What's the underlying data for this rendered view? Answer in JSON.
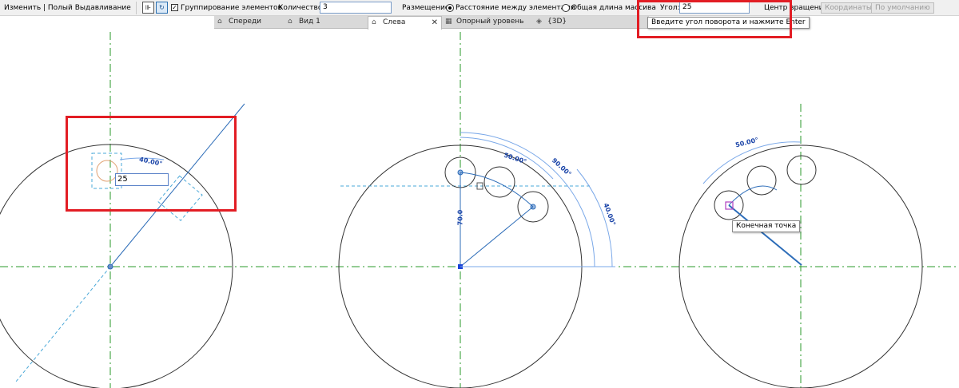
{
  "options_bar": {
    "context_label": "Изменить | Полый Выдавливание",
    "grouping_label": "Группирование элементов",
    "grouping_checked": true,
    "quantity_label": "Количество:",
    "quantity_value": "3",
    "placement_label": "Размещение:",
    "option_spacing": "Расстояние между элементами",
    "option_total": "Общая длина массива",
    "selected_option": "Расстояние между элементами",
    "angle_label": "Угол:",
    "angle_value": "25",
    "rotation_center_label": "Центр вращения:",
    "coordinates_button": "Координаты",
    "default_button": "По умолчанию"
  },
  "tabs": [
    {
      "label": "Спереди",
      "icon": "house-icon",
      "active": false
    },
    {
      "label": "Вид 1",
      "icon": "house-icon",
      "active": false
    },
    {
      "label": "Слева",
      "icon": "house-icon",
      "active": true
    },
    {
      "label": "Опорный уровень",
      "icon": "floorplan-icon",
      "active": false
    },
    {
      "label": "{3D}",
      "icon": "cube-icon",
      "active": false
    }
  ],
  "tooltips": {
    "angle_hint": "Введите угол поворота и нажмите Enter",
    "endpoint": "Конечная точка"
  },
  "views": {
    "left": {
      "input_value": "25",
      "angle_dim": "40.00°"
    },
    "middle": {
      "dim_50": "50.00°",
      "dim_90": "90.00°",
      "dim_40": "40.00°",
      "dim_70": "70.0"
    },
    "right": {
      "dim_50": "50.00°"
    }
  },
  "colors": {
    "highlight": "#e21d24",
    "dimension": "#1a44a8",
    "axis": "#2a9a2a",
    "workplane": "#4aa8d8"
  }
}
